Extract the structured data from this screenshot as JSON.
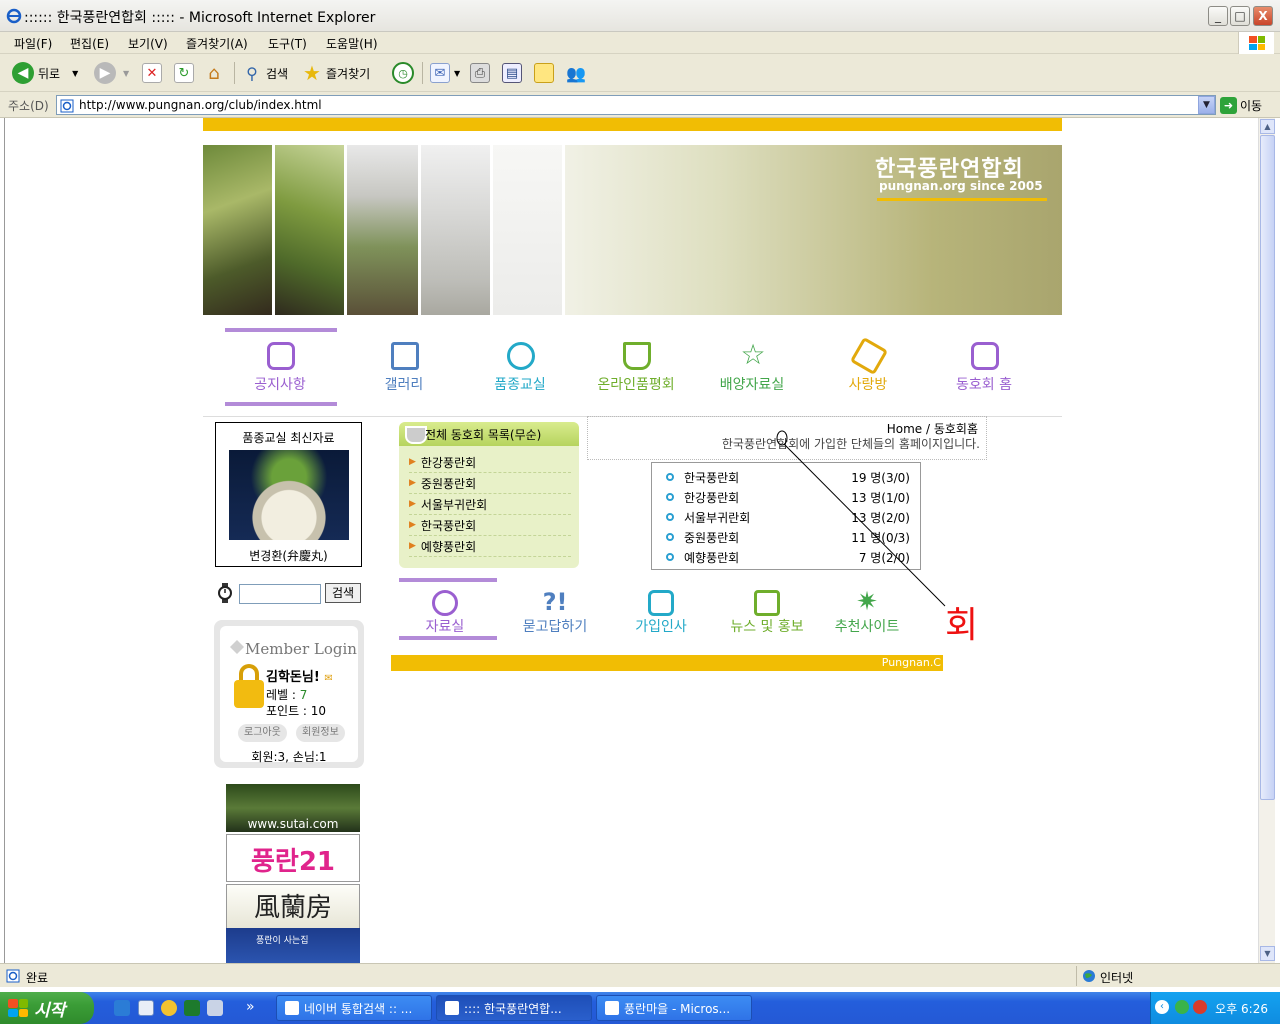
{
  "window": {
    "title": ":::::: 한국풍란연합회 ::::: - Microsoft Internet Explorer",
    "min": "_",
    "max": "□",
    "close": "X"
  },
  "menu": [
    "파일(F)",
    "편집(E)",
    "보기(V)",
    "즐겨찾기(A)",
    "도구(T)",
    "도움말(H)"
  ],
  "toolbar": {
    "back": "뒤로",
    "search": "검색",
    "favorites": "즐겨찾기"
  },
  "address": {
    "label": "주소(D)",
    "url": "http://www.pungnan.org/club/index.html",
    "go": "이동"
  },
  "banner": {
    "site_name": "한국풍란연합회",
    "site_sub": "pungnan.org  since 2005"
  },
  "main_nav": [
    {
      "label": "공지사항",
      "color": "#9a5fd0"
    },
    {
      "label": "갤러리",
      "color": "#4f7fbf"
    },
    {
      "label": "품종교실",
      "color": "#23a9c8"
    },
    {
      "label": "온라인품평회",
      "color": "#6fae2c"
    },
    {
      "label": "배양자료실",
      "color": "#43a64b"
    },
    {
      "label": "사랑방",
      "color": "#e2a90c"
    },
    {
      "label": "동호회 홈",
      "color": "#9a5fd0"
    }
  ],
  "latest": {
    "title": "품종교실 최신자료",
    "caption": "변경환(弁慶丸)"
  },
  "search": {
    "button": "검색"
  },
  "login": {
    "title": "Member Login",
    "name": "김학돈님!",
    "level_label": "레벨 : ",
    "level": "7",
    "points": "포인트 : 10",
    "logout": "로그아웃",
    "info": "회원정보",
    "counts": "회원:3,   손님:1"
  },
  "ads": [
    "www.sutai.com",
    "풍란21",
    "風蘭房",
    "풍란이 사는집"
  ],
  "club_list": {
    "header": "전체 동호회 목록(무순)",
    "items": [
      "한강풍란회",
      "중원풍란회",
      "서울부귀란회",
      "한국풍란회",
      "예향풍란회"
    ]
  },
  "info": {
    "path": "Home / 동호회홈",
    "desc": "한국풍란연합회에 가입한 단체들의 홈페이지입니다."
  },
  "stats": [
    {
      "name": "한국풍란회",
      "count": "19 명(3/0)"
    },
    {
      "name": "한강풍란회",
      "count": "13 명(1/0)"
    },
    {
      "name": "서울부귀란회",
      "count": "13 명(2/0)"
    },
    {
      "name": "중원풍란회",
      "count": "11 명(0/3)"
    },
    {
      "name": "예향풍란회",
      "count": "7 명(2/0)"
    }
  ],
  "sub_nav": [
    {
      "label": "자료실",
      "color": "#9a5fd0"
    },
    {
      "label": "묻고답하기",
      "color": "#4f7fbf"
    },
    {
      "label": "가입인사",
      "color": "#23a9c8"
    },
    {
      "label": "뉴스 및 홍보",
      "color": "#6fae2c"
    },
    {
      "label": "추천사이트",
      "color": "#43a64b"
    }
  ],
  "footer": "Pungnan.C",
  "annotation": "회",
  "status": {
    "text": "완료",
    "zone": "인터넷"
  },
  "taskbar": {
    "start": "시작",
    "tasks": [
      "네이버 통합검색 :: ...",
      ":::: 한국풍란연합...",
      "풍란마을 - Micros..."
    ],
    "clock": "오후 6:26"
  },
  "colors": {
    "accent_yellow": "#f1bd04",
    "nav_purple": "#b38bd8"
  }
}
